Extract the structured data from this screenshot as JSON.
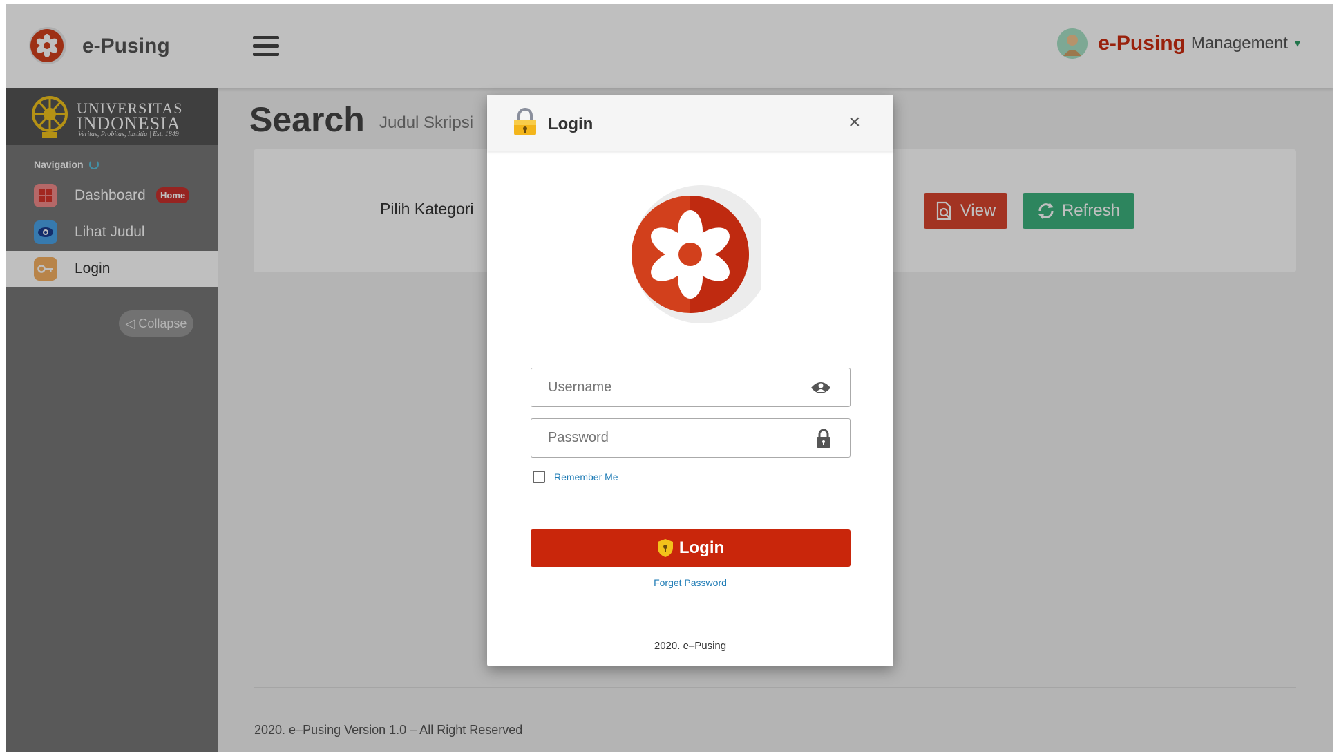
{
  "header": {
    "app_name": "e-Pusing",
    "user_brand": "e-Pusing",
    "user_role": "Management",
    "caret": "▾"
  },
  "sidebar": {
    "institution_line1": "UNIVERSITAS",
    "institution_line2": "INDONESIA",
    "institution_motto": "Veritas, Probitas, Iustitia | Est. 1849",
    "nav_title": "Navigation",
    "items": [
      {
        "label": "Dashboard",
        "badge": "Home",
        "icon": "dashboard-icon"
      },
      {
        "label": "Lihat Judul",
        "icon": "eye-icon"
      },
      {
        "label": "Login",
        "icon": "key-icon"
      }
    ],
    "collapse_label": "◁ Collapse"
  },
  "main": {
    "title": "Search",
    "subtitle": "Judul Skripsi",
    "category_label": "Pilih Kategori",
    "view_label": "View",
    "refresh_label": "Refresh",
    "footer": "2020. e–Pusing Version 1.0 – All Right Reserved"
  },
  "modal": {
    "title": "Login",
    "close": "×",
    "username_placeholder": "Username",
    "password_placeholder": "Password",
    "remember_label": "Remember Me",
    "login_label": "Login",
    "forget_label": "Forget Password",
    "footer": "2020. e–Pusing"
  },
  "colors": {
    "brand_red": "#cc2d10",
    "login_button": "#c9260b",
    "view_button": "#d9442e",
    "refresh_button": "#3db27e",
    "sidebar": "#777777"
  }
}
